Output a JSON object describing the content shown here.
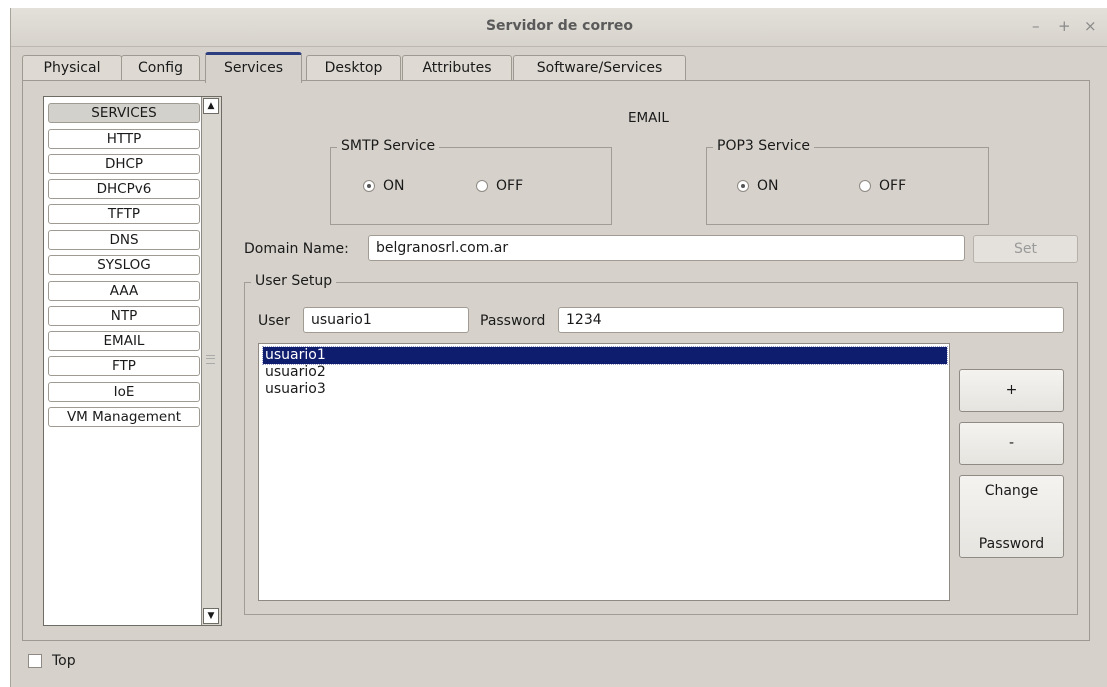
{
  "window": {
    "title": "Servidor de correo",
    "controls": [
      "–",
      "+",
      "×"
    ]
  },
  "tabs": [
    {
      "label": "Physical",
      "active": false
    },
    {
      "label": "Config",
      "active": false
    },
    {
      "label": "Services",
      "active": true
    },
    {
      "label": "Desktop",
      "active": false
    },
    {
      "label": "Attributes",
      "active": false
    },
    {
      "label": "Software/Services",
      "active": false
    }
  ],
  "sidebar": {
    "items": [
      "SERVICES",
      "HTTP",
      "DHCP",
      "DHCPv6",
      "TFTP",
      "DNS",
      "SYSLOG",
      "AAA",
      "NTP",
      "EMAIL",
      "FTP",
      "IoE",
      "VM Management"
    ],
    "selected": "SERVICES"
  },
  "email": {
    "title": "EMAIL",
    "smtp": {
      "label": "SMTP Service",
      "on": "ON",
      "off": "OFF",
      "value": "ON"
    },
    "pop3": {
      "label": "POP3 Service",
      "on": "ON",
      "off": "OFF",
      "value": "ON"
    },
    "domain": {
      "label": "Domain Name:",
      "value": "belgranosrl.com.ar",
      "set_label": "Set"
    },
    "user_setup": {
      "label": "User Setup",
      "user_label": "User",
      "user_value": "usuario1",
      "password_label": "Password",
      "password_value": "1234",
      "users": [
        "usuario1",
        "usuario2",
        "usuario3"
      ],
      "selected_user": "usuario1",
      "add_label": "+",
      "remove_label": "-",
      "change_line1": "Change",
      "change_line2": "Password"
    }
  },
  "footer": {
    "top_label": "Top",
    "top_checked": false
  },
  "colors": {
    "selection": "#0f1d6e",
    "active_tab_accent": "#2c3e80",
    "panel": "#d6d2cb"
  }
}
